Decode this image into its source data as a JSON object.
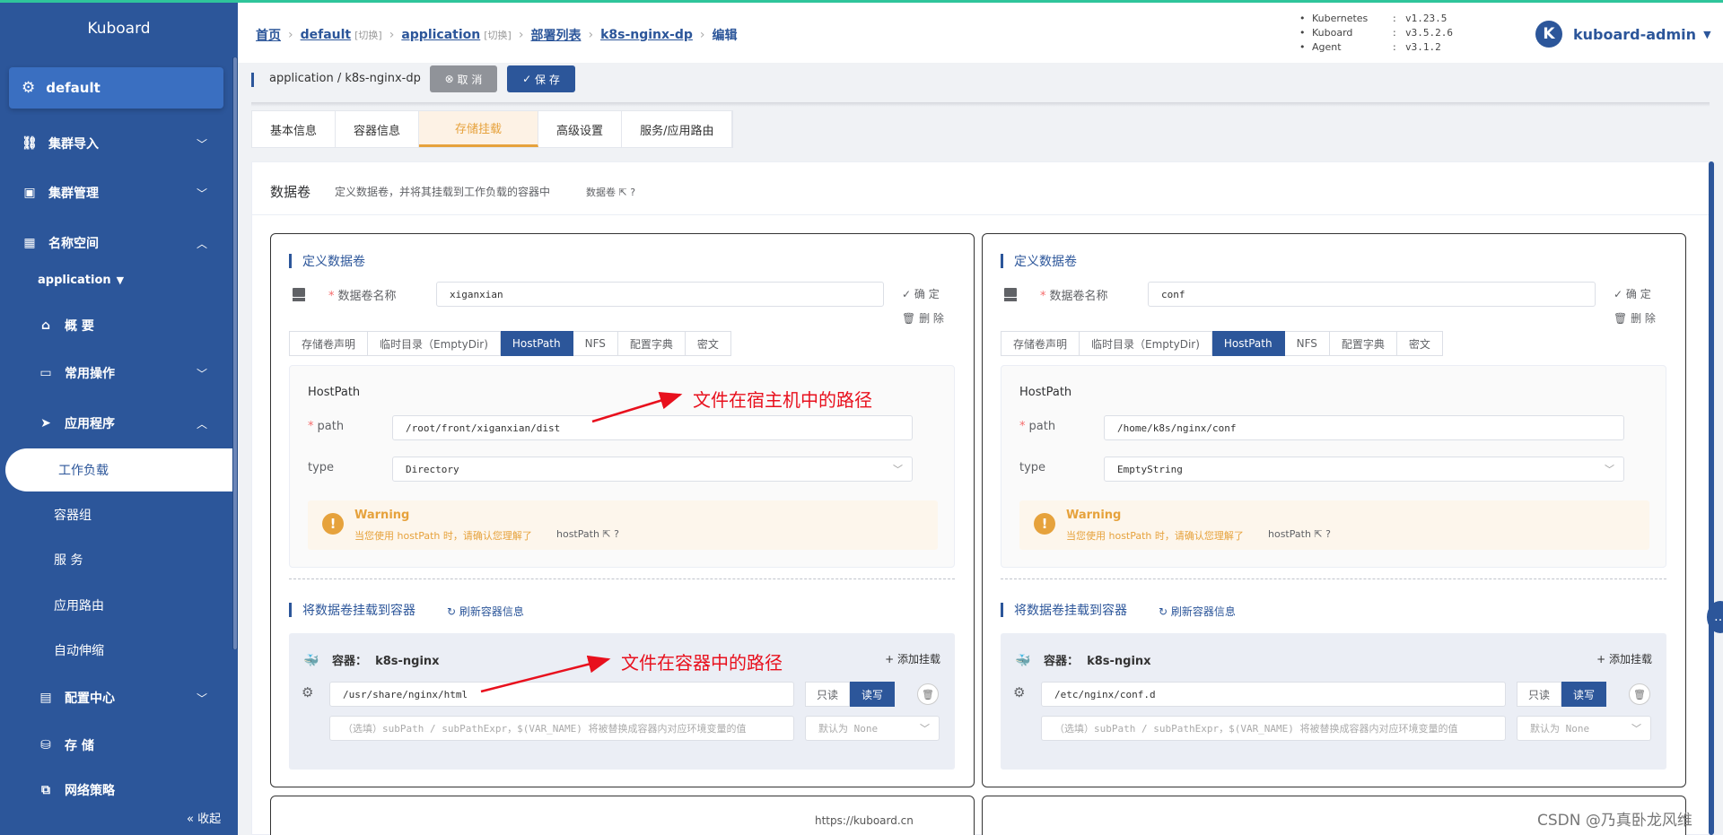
{
  "sidebar": {
    "brand": "Kuboard",
    "cluster": "default",
    "items": [
      {
        "label": "集群导入"
      },
      {
        "label": "集群管理"
      },
      {
        "label": "名称空间"
      }
    ],
    "namespace": "application",
    "ns_items": [
      {
        "label": "概 要"
      },
      {
        "label": "常用操作"
      },
      {
        "label": "应用程序"
      }
    ],
    "active": "工作负载",
    "subs": [
      "容器组",
      "服 务",
      "应用路由",
      "自动伸缩"
    ],
    "bottom": [
      {
        "label": "配置中心"
      },
      {
        "label": "存 储"
      },
      {
        "label": "网络策略"
      }
    ],
    "collapse": "收起"
  },
  "breadcrumb": {
    "home": "首页",
    "cluster": "default",
    "cluster_switch": "[切换]",
    "namespace": "application",
    "namespace_switch": "[切换]",
    "list": "部署列表",
    "name": "k8s-nginx-dp",
    "current": "编辑"
  },
  "versions": [
    {
      "k": "Kubernetes",
      "v": "v1.23.5"
    },
    {
      "k": "Kuboard",
      "v": "v3.5.2.6"
    },
    {
      "k": "Agent",
      "v": "v3.1.2"
    }
  ],
  "user": {
    "initial": "K",
    "name": "kuboard-admin"
  },
  "actions": {
    "path": "application / k8s-nginx-dp",
    "cancel": "取 消",
    "save": "保 存"
  },
  "tabs": [
    "基本信息",
    "容器信息",
    "存储挂载",
    "高级设置",
    "服务/应用路由"
  ],
  "panel": {
    "title": "数据卷",
    "desc": "定义数据卷，并将其挂载到工作负载的容器中",
    "link": "数据卷"
  },
  "cards": [
    {
      "section1": "定义数据卷",
      "name_label": "数据卷名称",
      "name_value": "xiganxian",
      "confirm": "确 定",
      "delete": "删 除",
      "vtabs": [
        "存储卷声明",
        "临时目录（EmptyDir)",
        "HostPath",
        "NFS",
        "配置字典",
        "密文"
      ],
      "hp_title": "HostPath",
      "path_label": "path",
      "path_value": "/root/front/xiganxian/dist",
      "type_label": "type",
      "type_value": "Directory",
      "warn_title": "Warning",
      "warn_desc": "当您使用 hostPath 时，请确认您理解了",
      "warn_link": "hostPath",
      "section2": "将数据卷挂载到容器",
      "refresh": "刷新容器信息",
      "container_label": "容器：",
      "container_name": "k8s-nginx",
      "add_mount": "添加挂载",
      "mount_path": "/usr/share/nginx/html",
      "readonly": "只读",
      "readwrite": "读写",
      "subpath_ph": "（选填）subPath / subPathExpr，$(VAR_NAME) 将被替换成容器内对应环境变量的值",
      "default_ph": "默认为 None"
    },
    {
      "section1": "定义数据卷",
      "name_label": "数据卷名称",
      "name_value": "conf",
      "confirm": "确 定",
      "delete": "删 除",
      "vtabs": [
        "存储卷声明",
        "临时目录（EmptyDir)",
        "HostPath",
        "NFS",
        "配置字典",
        "密文"
      ],
      "hp_title": "HostPath",
      "path_label": "path",
      "path_value": "/home/k8s/nginx/conf",
      "type_label": "type",
      "type_value": "EmptyString",
      "warn_title": "Warning",
      "warn_desc": "当您使用 hostPath 时，请确认您理解了",
      "warn_link": "hostPath",
      "section2": "将数据卷挂载到容器",
      "refresh": "刷新容器信息",
      "container_label": "容器：",
      "container_name": "k8s-nginx",
      "add_mount": "添加挂载",
      "mount_path": "/etc/nginx/conf.d",
      "readonly": "只读",
      "readwrite": "读写",
      "subpath_ph": "（选填）subPath / subPathExpr，$(VAR_NAME) 将被替换成容器内对应环境变量的值",
      "default_ph": "默认为 None"
    }
  ],
  "annotations": {
    "host": "文件在宿主机中的路径",
    "container": "文件在容器中的路径"
  },
  "footer": "https://kuboard.cn",
  "watermark": "CSDN @乃真卧龙风维",
  "colors": {
    "primary": "#2c569a",
    "warning": "#e6a23c",
    "accent_line": "#2fc59b",
    "annotation": "#e8101d"
  }
}
